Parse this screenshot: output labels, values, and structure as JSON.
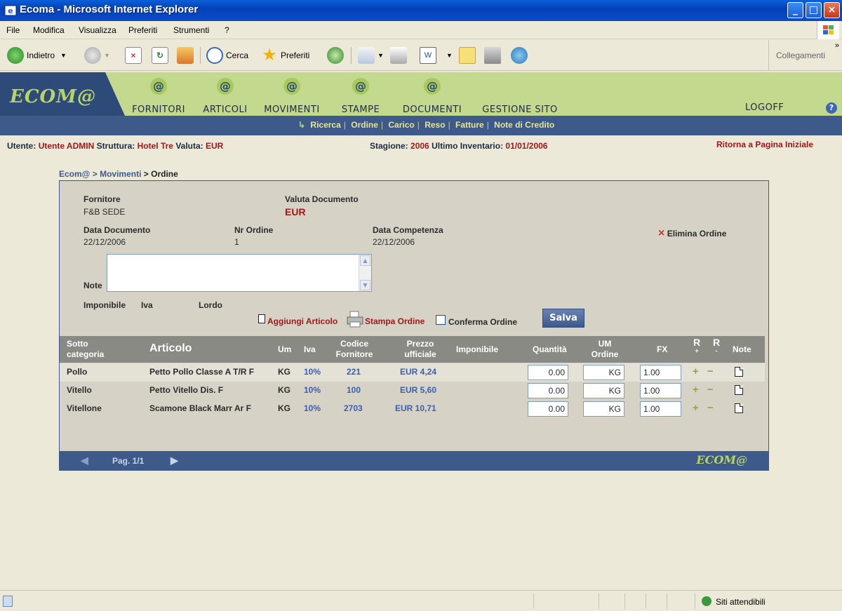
{
  "window": {
    "title": "Ecoma - Microsoft Internet Explorer"
  },
  "menu": [
    "File",
    "Modifica",
    "Visualizza",
    "Preferiti",
    "Strumenti",
    "?"
  ],
  "toolbar": {
    "back": "Indietro",
    "search": "Cerca",
    "favorites": "Preferiti",
    "links": "Collegamenti"
  },
  "app": {
    "logo": "ECOM@",
    "nav": [
      "FORNITORI",
      "ARTICOLI",
      "MOVIMENTI",
      "STAMPE",
      "DOCUMENTI",
      "GESTIONE SITO"
    ],
    "logoff": "LOGOFF",
    "subnav": [
      "Ricerca",
      "Ordine",
      "Carico",
      "Reso",
      "Fatture",
      "Note di Credito"
    ]
  },
  "info": {
    "user_label": "Utente:",
    "user": "Utente ADMIN",
    "struct_label": "Struttura:",
    "struct": "Hotel Tre",
    "currency_label": "Valuta:",
    "currency": "EUR",
    "season_label": "Stagione:",
    "season": "2006",
    "inventory_label": "Ultimo Inventario:",
    "inventory": "01/01/2006",
    "home_link": "Ritorna a Pagina Iniziale"
  },
  "breadcrumb": {
    "a": "Ecom@",
    "b": "Movimenti",
    "current": "Ordine"
  },
  "order": {
    "supplier_label": "Fornitore",
    "supplier": "F&B SEDE",
    "currency_label": "Valuta Documento",
    "currency": "EUR",
    "date_label": "Data Documento",
    "date": "22/12/2006",
    "nr_label": "Nr Ordine",
    "nr": "1",
    "comp_label": "Data Competenza",
    "comp": "22/12/2006",
    "delete": "Elimina Ordine",
    "note_label": "Note",
    "imponibile": "Imponibile",
    "iva": "Iva",
    "lordo": "Lordo",
    "add_item": "Aggiungi Articolo",
    "print": "Stampa Ordine",
    "confirm": "Conferma Ordine",
    "save": "Salva"
  },
  "table": {
    "headers": {
      "sub_a": "Sotto",
      "sub_b": "categoria",
      "articolo": "Articolo",
      "um": "Um",
      "iva": "Iva",
      "code_a": "Codice",
      "code_b": "Fornitore",
      "price_a": "Prezzo",
      "price_b": "ufficiale",
      "imponibile": "Imponibile",
      "qty": "Quantità",
      "umo_a": "UM",
      "umo_b": "Ordine",
      "fx": "FX",
      "r1": "R",
      "r1s": "+",
      "r2": "R",
      "r2s": "-",
      "note": "Note"
    },
    "rows": [
      {
        "sub": "Pollo",
        "art": "Petto Pollo Classe A T/R F",
        "um": "KG",
        "iva": "10%",
        "code": "221",
        "price": "EUR 4,24",
        "qty": "0.00",
        "umo": "KG",
        "fx": "1.00"
      },
      {
        "sub": "Vitello",
        "art": "Petto Vitello Dis. F",
        "um": "KG",
        "iva": "10%",
        "code": "100",
        "price": "EUR 5,60",
        "qty": "0.00",
        "umo": "KG",
        "fx": "1.00"
      },
      {
        "sub": "Vitellone",
        "art": "Scamone Black Marr Ar F",
        "um": "KG",
        "iva": "10%",
        "code": "2703",
        "price": "EUR 10,71",
        "qty": "0.00",
        "umo": "KG",
        "fx": "1.00"
      }
    ]
  },
  "pager": {
    "page": "Pag. 1/1",
    "logo": "ECOM@"
  },
  "status": {
    "zone": "Siti attendibili"
  }
}
